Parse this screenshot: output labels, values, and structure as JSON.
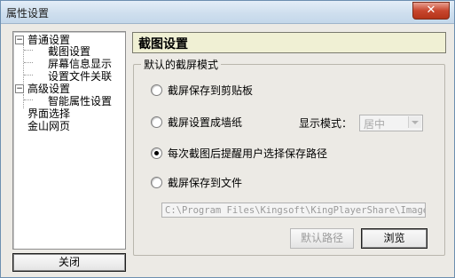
{
  "window": {
    "title": "属性设置",
    "close_glyph": "✕"
  },
  "sidebar": {
    "items": [
      {
        "label": "普通设置",
        "expanded": true
      },
      {
        "label": "截图设置"
      },
      {
        "label": "屏幕信息显示"
      },
      {
        "label": "设置文件关联"
      },
      {
        "label": "高级设置",
        "expanded": true
      },
      {
        "label": "智能属性设置"
      },
      {
        "label": "界面选择"
      },
      {
        "label": "金山网页"
      }
    ],
    "expand_glyph": "−",
    "close_label": "关闭"
  },
  "main": {
    "header_title": "截图设置",
    "group_title": "默认的截屏模式",
    "options": [
      {
        "label": "截屏保存到剪贴板",
        "checked": false
      },
      {
        "label": "截屏设置成墙纸",
        "checked": false
      },
      {
        "label": "每次截图后提醒用户选择保存路径",
        "checked": true
      },
      {
        "label": "截屏保存到文件",
        "checked": false
      }
    ],
    "display_mode_label": "显示模式：",
    "display_mode_value": "居中",
    "save_path": "C:\\Program Files\\Kingsoft\\KingPlayerShare\\Images\\",
    "default_path_button": "默认路径",
    "browse_button": "浏览"
  }
}
